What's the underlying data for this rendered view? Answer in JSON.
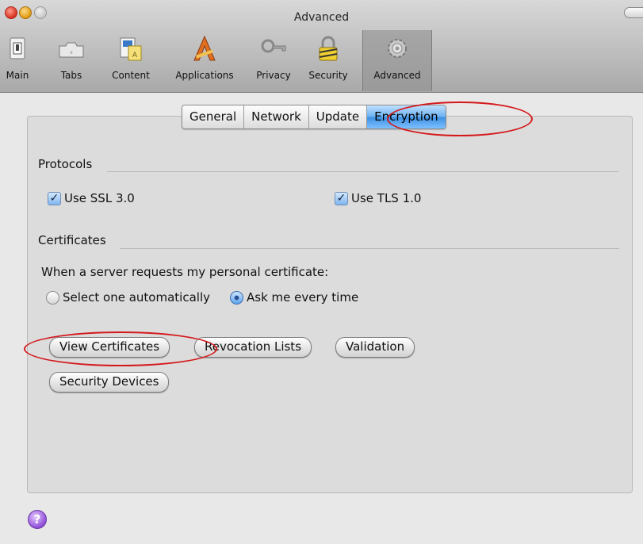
{
  "window": {
    "title": "Advanced"
  },
  "toolbar": {
    "items": [
      {
        "label": "Main",
        "icon": "switch-icon"
      },
      {
        "label": "Tabs",
        "icon": "tabs-icon"
      },
      {
        "label": "Content",
        "icon": "content-icon"
      },
      {
        "label": "Applications",
        "icon": "applications-icon"
      },
      {
        "label": "Privacy",
        "icon": "key-icon"
      },
      {
        "label": "Security",
        "icon": "lock-icon"
      },
      {
        "label": "Advanced",
        "icon": "gear-icon"
      }
    ],
    "selected": "Advanced"
  },
  "tabs": [
    "General",
    "Network",
    "Update",
    "Encryption"
  ],
  "active_tab": "Encryption",
  "protocols": {
    "heading": "Protocols",
    "ssl": {
      "label": "Use SSL 3.0",
      "checked": true
    },
    "tls": {
      "label": "Use TLS 1.0",
      "checked": true
    }
  },
  "certificates": {
    "heading": "Certificates",
    "prompt": "When a server requests my personal certificate:",
    "option_auto": "Select one automatically",
    "option_ask": "Ask me every time",
    "selected_option": "Ask me every time"
  },
  "buttons": {
    "view_certificates": "View Certificates",
    "revocation_lists": "Revocation Lists",
    "validation": "Validation",
    "security_devices": "Security Devices"
  },
  "help": {
    "label": "?"
  },
  "colors": {
    "annotation": "#d4191b",
    "active_tab": "#3b8fe2"
  }
}
